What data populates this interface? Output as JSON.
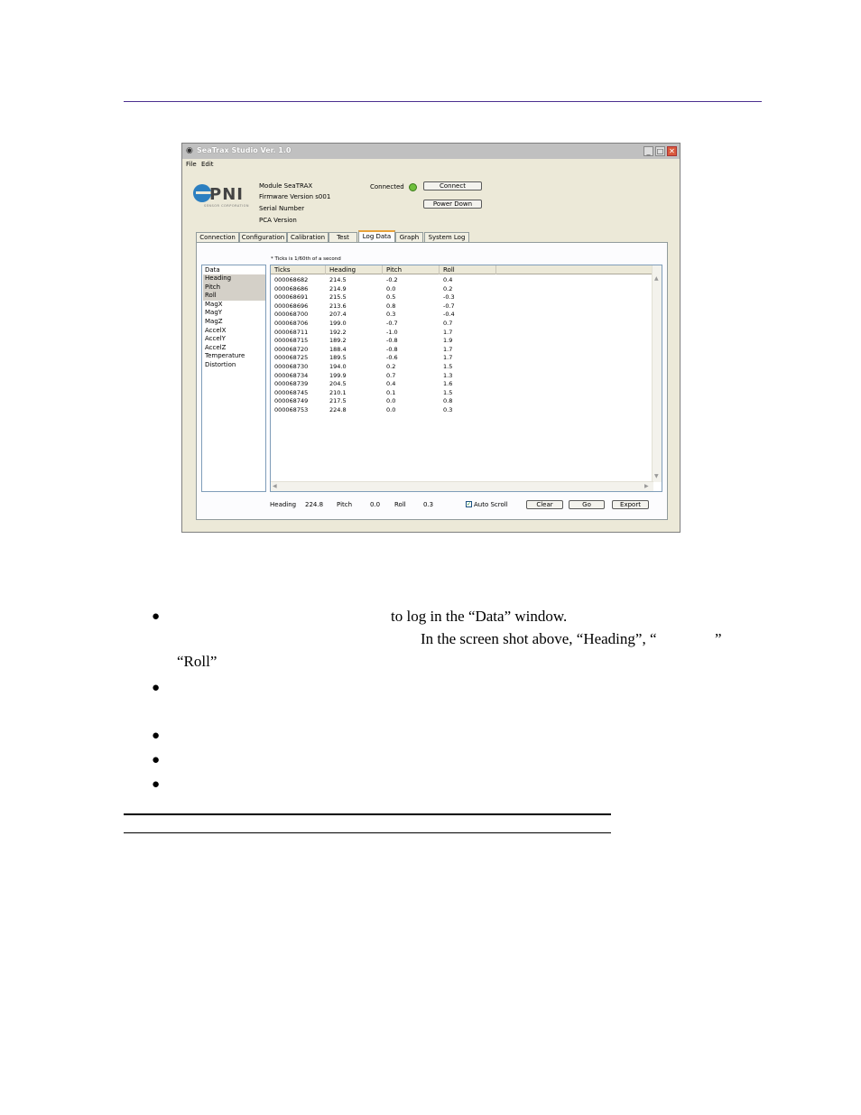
{
  "window": {
    "title": "SeaTrax Studio Ver. 1.0",
    "menu": [
      "File",
      "Edit"
    ],
    "logo": {
      "text": "PNI",
      "subtitle": "SENSOR CORPORATION"
    },
    "info": [
      "Module SeaTRAX",
      "Firmware Version s001",
      "Serial Number",
      "PCA Version"
    ],
    "connected_label": "Connected",
    "connect_button": "Connect",
    "power_down_button": "Power Down",
    "tabs": [
      "Connection",
      "Configuration",
      "Calibration",
      "Test",
      "Log Data",
      "Graph",
      "System Log"
    ],
    "active_tab": "Log Data",
    "ticks_note": "* Ticks is 1/60th of a second",
    "data_list": {
      "header": "Data",
      "items": [
        "Heading",
        "Pitch",
        "Roll",
        "MagX",
        "MagY",
        "MagZ",
        "AccelX",
        "AccelY",
        "AccelZ",
        "Temperature",
        "Distortion"
      ],
      "selected": [
        "Heading",
        "Pitch",
        "Roll"
      ]
    },
    "table": {
      "headers": [
        "Ticks",
        "Heading",
        "Pitch",
        "Roll"
      ],
      "rows": [
        [
          "000068682",
          "214.5",
          "-0.2",
          "0.4"
        ],
        [
          "000068686",
          "214.9",
          "0.0",
          "0.2"
        ],
        [
          "000068691",
          "215.5",
          "0.5",
          "-0.3"
        ],
        [
          "000068696",
          "213.6",
          "0.8",
          "-0.7"
        ],
        [
          "000068700",
          "207.4",
          "0.3",
          "-0.4"
        ],
        [
          "000068706",
          "199.0",
          "-0.7",
          "0.7"
        ],
        [
          "000068711",
          "192.2",
          "-1.0",
          "1.7"
        ],
        [
          "000068715",
          "189.2",
          "-0.8",
          "1.9"
        ],
        [
          "000068720",
          "188.4",
          "-0.8",
          "1.7"
        ],
        [
          "000068725",
          "189.5",
          "-0.6",
          "1.7"
        ],
        [
          "000068730",
          "194.0",
          "0.2",
          "1.5"
        ],
        [
          "000068734",
          "199.9",
          "0.7",
          "1.3"
        ],
        [
          "000068739",
          "204.5",
          "0.4",
          "1.6"
        ],
        [
          "000068745",
          "210.1",
          "0.1",
          "1.5"
        ],
        [
          "000068749",
          "217.5",
          "0.0",
          "0.8"
        ],
        [
          "000068753",
          "224.8",
          "0.0",
          "0.3"
        ]
      ]
    },
    "status": {
      "heading_label": "Heading",
      "heading_value": "224.8",
      "pitch_label": "Pitch",
      "pitch_value": "0.0",
      "roll_label": "Roll",
      "roll_value": "0.3"
    },
    "auto_scroll": {
      "label": "Auto Scroll",
      "checked": true
    },
    "buttons": {
      "clear": "Clear",
      "go": "Go",
      "export": "Export"
    }
  },
  "document": {
    "line1": "to log in the “Data” window.",
    "line2": "In the screen shot above, “Heading”, “",
    "line2_end": "”",
    "line3": "“Roll”"
  }
}
